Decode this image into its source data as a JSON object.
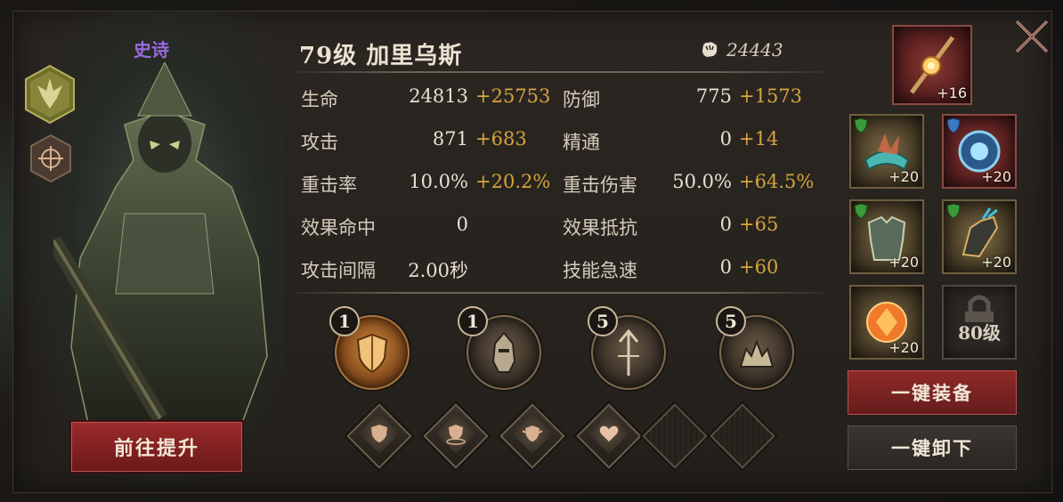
{
  "hero": {
    "rarity": "史诗",
    "level_name": "79级 加里乌斯",
    "power": "24443",
    "upgrade_label": "前往提升"
  },
  "stats": [
    {
      "label": "生命",
      "base": "24813",
      "bonus": "+25753"
    },
    {
      "label": "防御",
      "base": "775",
      "bonus": "+1573"
    },
    {
      "label": "攻击",
      "base": "871",
      "bonus": "+683"
    },
    {
      "label": "精通",
      "base": "0",
      "bonus": "+14"
    },
    {
      "label": "重击率",
      "base": "10.0%",
      "bonus": "+20.2%"
    },
    {
      "label": "重击伤害",
      "base": "50.0%",
      "bonus": "+64.5%"
    },
    {
      "label": "效果命中",
      "base": "0",
      "bonus": ""
    },
    {
      "label": "效果抵抗",
      "base": "0",
      "bonus": "+65"
    },
    {
      "label": "攻击间隔",
      "base": "2.00秒",
      "bonus": ""
    },
    {
      "label": "技能急速",
      "base": "0",
      "bonus": "+60"
    }
  ],
  "skills": [
    {
      "level": "1",
      "icon": "shield-skill-icon"
    },
    {
      "level": "1",
      "icon": "knight-helm-skill-icon"
    },
    {
      "level": "5",
      "icon": "trident-skill-icon"
    },
    {
      "level": "5",
      "icon": "beast-skill-icon"
    }
  ],
  "talents": [
    {
      "icon": "shield-talent-icon",
      "filled": true
    },
    {
      "icon": "shield-ring-talent-icon",
      "filled": true
    },
    {
      "icon": "shield-spike-talent-icon",
      "filled": true
    },
    {
      "icon": "heart-talent-icon",
      "filled": true
    },
    {
      "icon": "empty-talent-slot",
      "filled": false
    },
    {
      "icon": "empty-talent-slot",
      "filled": false
    }
  ],
  "equipment": {
    "weapon": {
      "level": "+16",
      "icon": "staff-icon"
    },
    "slots": [
      {
        "level": "+20",
        "icon": "crown-icon"
      },
      {
        "level": "+20",
        "icon": "orb-icon"
      },
      {
        "level": "+20",
        "icon": "armor-icon"
      },
      {
        "level": "+20",
        "icon": "gauntlet-icon"
      },
      {
        "level": "+20",
        "icon": "gem-icon"
      },
      {
        "level": "80级",
        "icon": "lock-icon"
      }
    ],
    "equip_all_label": "一键装备",
    "unequip_all_label": "一键卸下"
  },
  "colors": {
    "rarity": "#9a6ae0",
    "bonus": "#d4a53c",
    "primary_button": "#8f2a28"
  }
}
